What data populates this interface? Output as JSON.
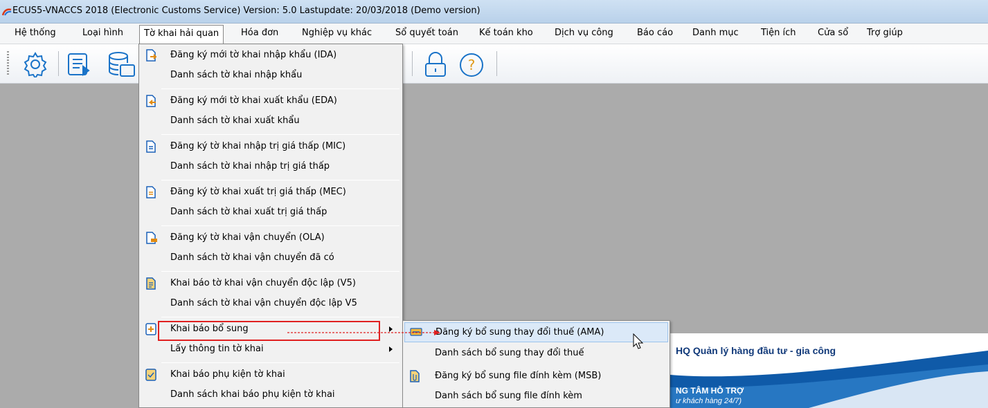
{
  "window": {
    "title": "ECUS5-VNACCS 2018 (Electronic Customs Service) Version: 5.0 Lastupdate: 20/03/2018 (Demo version)"
  },
  "menubar": {
    "items": [
      "Hệ thống",
      "Loại hình",
      "Tờ khai hải quan",
      "Hóa đơn",
      "Nghiệp vụ khác",
      "Sổ quyết toán",
      "Kế toán kho",
      "Dịch vụ công",
      "Báo cáo",
      "Danh mục",
      "Tiện ích",
      "Cửa sổ",
      "Trợ giúp"
    ],
    "open_item": "Tờ khai hải quan"
  },
  "toolbar": {
    "buttons": [
      "settings-gear-icon",
      "document-list-icon",
      "database-icon",
      "lock-icon",
      "help-icon"
    ]
  },
  "dropdown": {
    "items": [
      {
        "label": "Đăng ký mới tờ khai nhập khẩu (IDA)",
        "icon": "import-declaration-icon"
      },
      {
        "label": "Danh sách tờ khai nhập khẩu"
      },
      {
        "label": "Đăng ký mới tờ khai xuất khẩu (EDA)",
        "icon": "export-declaration-icon"
      },
      {
        "label": "Danh sách tờ khai xuất khẩu"
      },
      {
        "label": "Đăng ký tờ khai nhập trị giá thấp (MIC)",
        "icon": "low-value-import-icon"
      },
      {
        "label": "Danh sách tờ khai nhập trị giá thấp"
      },
      {
        "label": "Đăng ký tờ khai xuất trị giá thấp (MEC)",
        "icon": "low-value-export-icon"
      },
      {
        "label": "Danh sách tờ khai xuất trị giá thấp"
      },
      {
        "label": "Đăng ký tờ khai vận chuyển (OLA)",
        "icon": "transport-declaration-icon"
      },
      {
        "label": "Danh sách tờ khai vận chuyển đã có"
      },
      {
        "label": "Khai báo tờ khai vận chuyển độc lập (V5)",
        "icon": "independent-transport-icon"
      },
      {
        "label": "Danh sách tờ khai vận chuyển độc lập V5"
      },
      {
        "label": "Khai báo bổ sung",
        "icon": "supplementary-icon",
        "submenu": true
      },
      {
        "label": "Lấy thông tin tờ khai",
        "submenu": true
      },
      {
        "label": "Khai báo phụ kiện tờ khai",
        "icon": "attachment-declaration-icon"
      },
      {
        "label": "Danh sách khai báo phụ kiện tờ khai"
      }
    ]
  },
  "submenu": {
    "items": [
      {
        "label": "Đăng ký bổ sung thay đổi thuế (AMA)",
        "icon": "tax-change-icon",
        "hover": true
      },
      {
        "label": "Danh sách bổ sung thay đổi thuế"
      },
      {
        "label": "Đăng ký bổ sung file đính kèm (MSB)",
        "icon": "file-attachment-icon"
      },
      {
        "label": "Danh sách bổ sung file đính kèm"
      }
    ]
  },
  "banner": {
    "headline": "HQ Quản lý hàng đầu tư - gia công",
    "support_title": "NG TÂM HỖ TRỢ",
    "support_sub": "ư khách hàng 24/7)"
  },
  "colors": {
    "highlight_red": "#e02020",
    "menu_hover": "#dbe9f8",
    "banner_blue": "#123a7a"
  }
}
